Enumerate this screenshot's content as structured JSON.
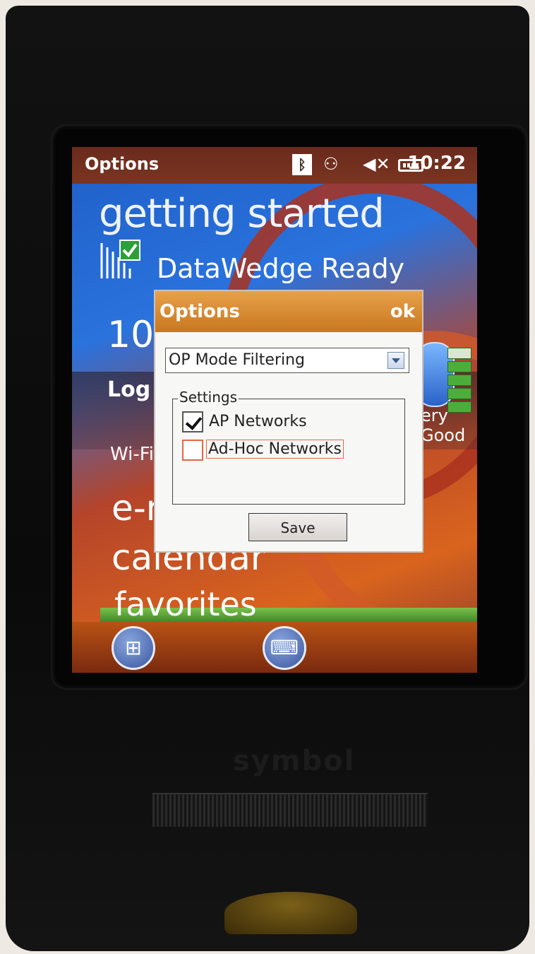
{
  "device": {
    "brand": "symbol"
  },
  "status_bar": {
    "title": "Options",
    "time": "10:22",
    "icons": [
      "bluetooth-icon",
      "sync-icon",
      "speaker-muted-icon",
      "battery-icon"
    ]
  },
  "today": {
    "getting_started": "getting started",
    "datawedge": "DataWedge Ready",
    "time_partial": "10:",
    "log_partial": "Log",
    "wifi_partial": "Wi-Fi:",
    "battery_partial": "ery Good",
    "email_partial": "e-m",
    "calendar": "calendar",
    "favorites": "favorites"
  },
  "dialog": {
    "title": "Options",
    "ok": "ok",
    "select_value": "OP Mode Filtering",
    "group_label": "Settings",
    "checkboxes": [
      {
        "label": "AP Networks",
        "checked": true
      },
      {
        "label": "Ad-Hoc Networks",
        "checked": false
      }
    ],
    "save_label": "Save"
  },
  "colors": {
    "dialog_header": "#d68a2e",
    "focus_outline": "#e06848",
    "titlebar": "#6a2a1c"
  }
}
